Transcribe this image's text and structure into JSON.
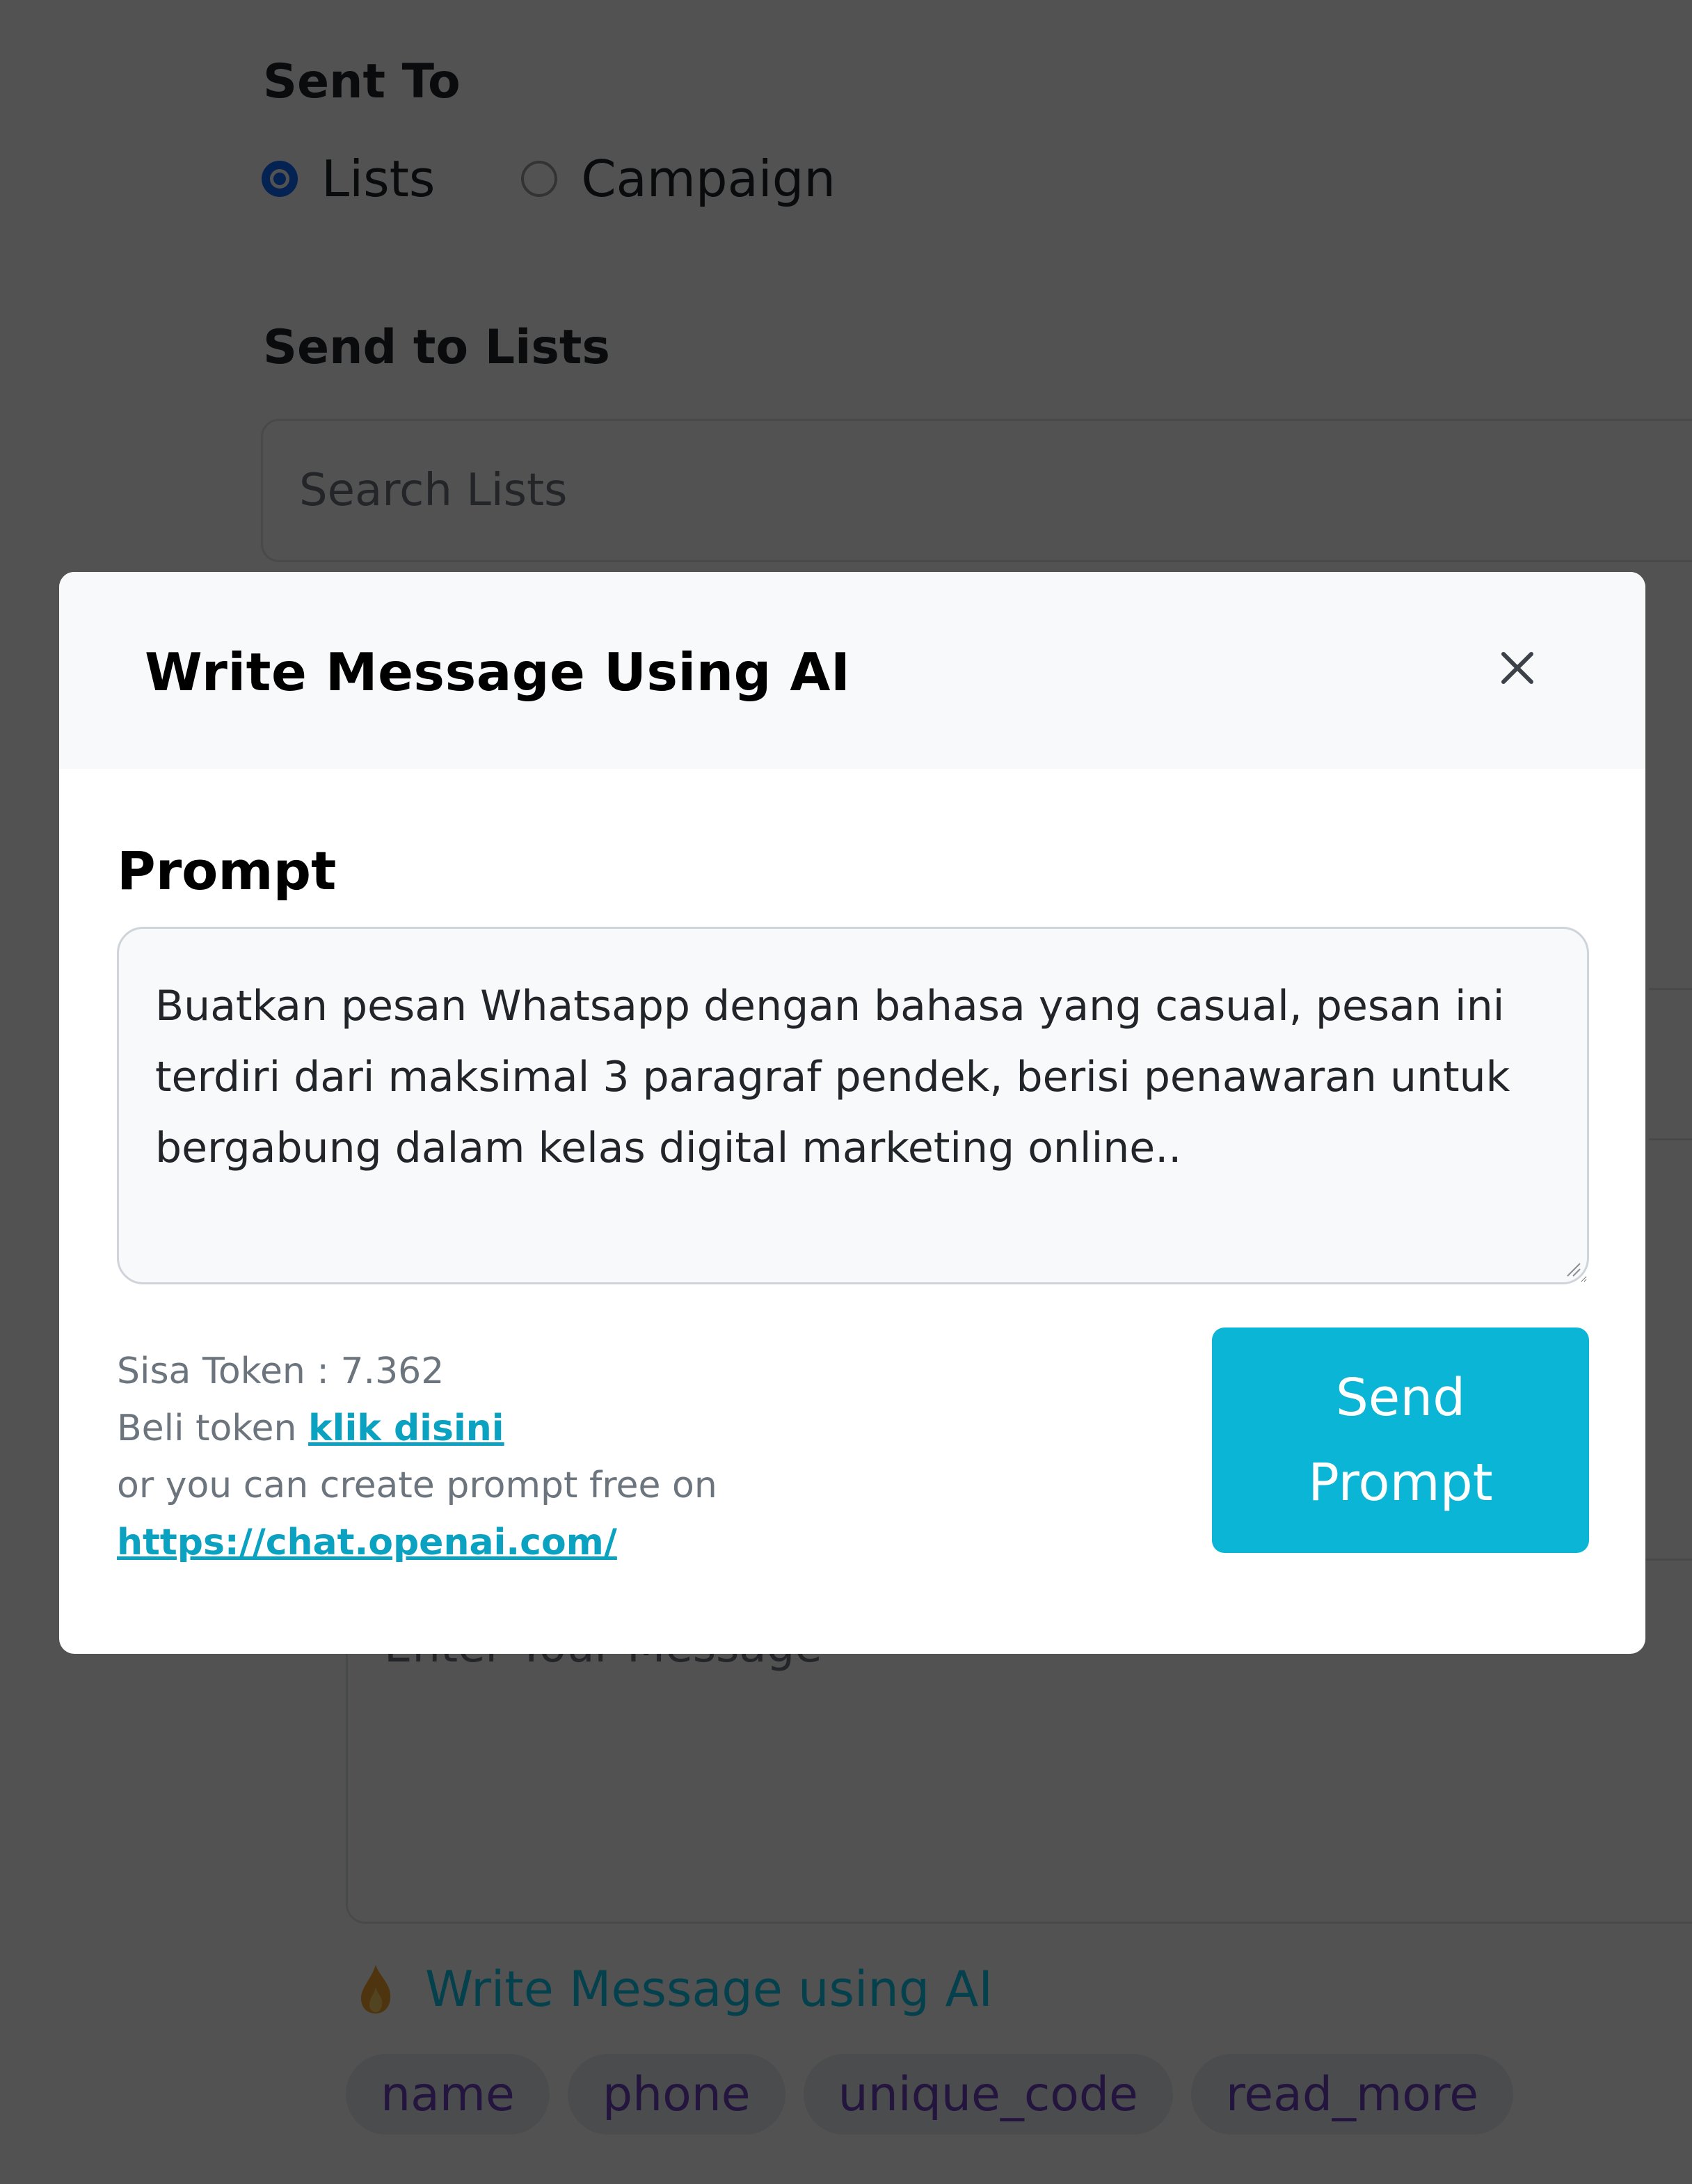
{
  "form": {
    "sent_to_label": "Sent To",
    "recipient_options": [
      {
        "label": "Lists",
        "selected": true
      },
      {
        "label": "Campaign",
        "selected": false
      }
    ],
    "send_to_lists_label": "Send to Lists",
    "search_lists_placeholder": "Search Lists",
    "message_placeholder": "Enter Your Message",
    "ai_link_label": "Write Message using AI",
    "ai_link_icon": "flame-icon",
    "variable_chips": [
      "name",
      "phone",
      "unique_code",
      "read_more"
    ]
  },
  "modal": {
    "title": "Write Message Using AI",
    "close_icon": "close-icon",
    "prompt_label": "Prompt",
    "prompt_value": "Buatkan pesan Whatsapp dengan bahasa yang casual, pesan ini terdiri dari maksimal 3 paragraf pendek, berisi penawaran untuk bergabung dalam kelas digital marketing online..",
    "token_label": "Sisa Token : 7.362",
    "buy_token_prefix": "Beli token ",
    "buy_token_link": "klik disini",
    "free_prompt_text": "or you can create prompt free on",
    "free_prompt_link": "https://chat.openai.com/",
    "send_button_label": "Send Prompt"
  },
  "colors": {
    "accent": "#0ab5d6",
    "link": "#0aa2c0",
    "radio_selected": "#0d6efd",
    "chip_text": "#6f42c1"
  }
}
